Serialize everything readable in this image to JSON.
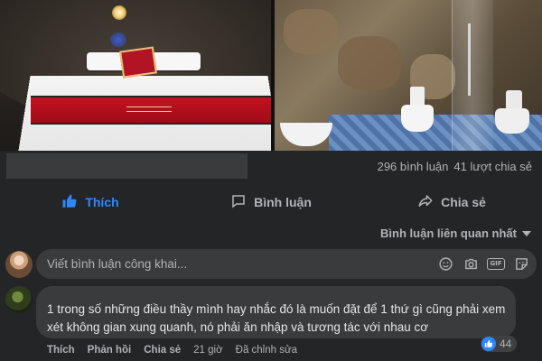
{
  "post": {
    "photos": [
      {
        "subject": "cave-bedroom"
      },
      {
        "subject": "cave-bathroom"
      }
    ]
  },
  "stats": {
    "comments": "296 bình luận",
    "shares": "41 lượt chia sẻ"
  },
  "actions": {
    "like": "Thích",
    "comment": "Bình luận",
    "share": "Chia sẻ"
  },
  "sort": {
    "label": "Bình luận liên quan nhất"
  },
  "composer": {
    "placeholder": "Viết bình luận công khai..."
  },
  "comment": {
    "text": "1 trong số những điều thầy mình hay nhắc đó là muốn đặt để 1 thứ gì cũng phải xem xét không gian xung quanh, nó phải ăn nhập và tương tác với nhau cơ",
    "reaction_count": "44",
    "like_label": "Thích",
    "reply_label": "Phản hồi",
    "share_label": "Chia sẻ",
    "time": "21 giờ",
    "edited": "Đã chỉnh sửa"
  },
  "colors": {
    "background": "#18191a",
    "surface": "#242526",
    "input": "#3a3b3c",
    "accent": "#2d88ff",
    "text_secondary": "#b0b3b8"
  },
  "icons": [
    "thumbs-up-icon",
    "comment-icon",
    "share-icon",
    "emoji-icon",
    "camera-icon",
    "gif-icon",
    "sticker-icon",
    "caret-down-icon"
  ]
}
